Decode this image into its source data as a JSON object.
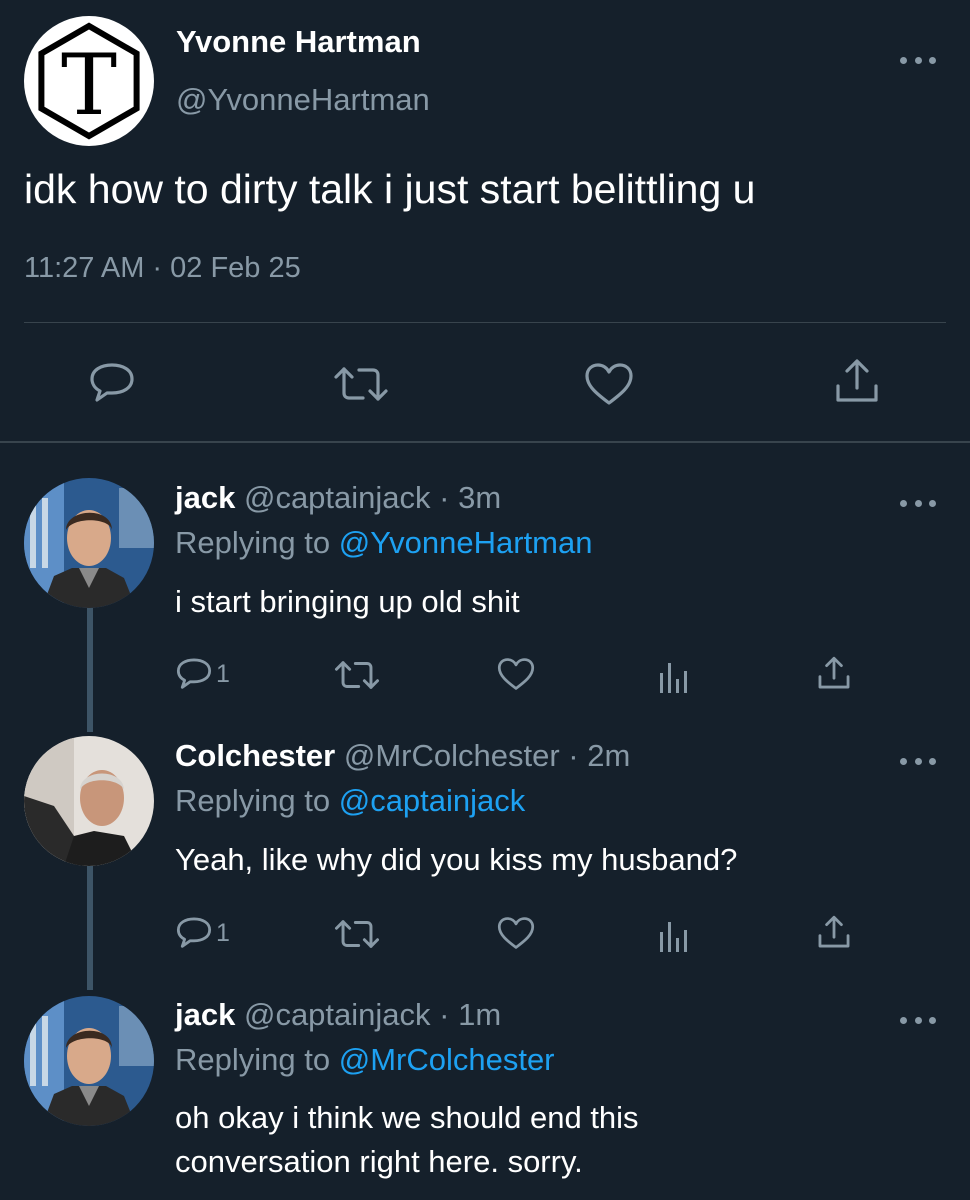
{
  "main_tweet": {
    "display_name": "Yvonne Hartman",
    "handle": "@YvonneHartman",
    "avatar_letter": "T",
    "text": "idk how to dirty talk i just start belittling u",
    "timestamp": "11:27 AM · 02 Feb 25"
  },
  "replies": [
    {
      "display_name": "jack",
      "handle_time": "@captainjack · 3m",
      "replying_prefix": "Replying to ",
      "replying_to": "@YvonneHartman",
      "text_lines": [
        "i start bringing up old shit"
      ],
      "reply_count": "1"
    },
    {
      "display_name": "Colchester",
      "handle_time": "@MrColchester · 2m",
      "replying_prefix": "Replying to ",
      "replying_to": "@captainjack",
      "text_lines": [
        "Yeah, like why did you kiss my husband?"
      ],
      "reply_count": "1"
    },
    {
      "display_name": "jack",
      "handle_time": "@captainjack · 1m",
      "replying_prefix": "Replying to ",
      "replying_to": "@MrColchester",
      "text_lines": [
        "oh okay i think we should end this",
        "conversation right here. sorry."
      ]
    }
  ],
  "icons": {
    "reply": "reply-icon",
    "retweet": "retweet-icon",
    "like": "heart-icon",
    "analytics": "analytics-icon",
    "share": "share-icon",
    "more": "more-icon"
  },
  "colors": {
    "background": "#15202b",
    "secondary_text": "#8899a6",
    "link": "#1da1f2",
    "divider": "#38444d"
  }
}
